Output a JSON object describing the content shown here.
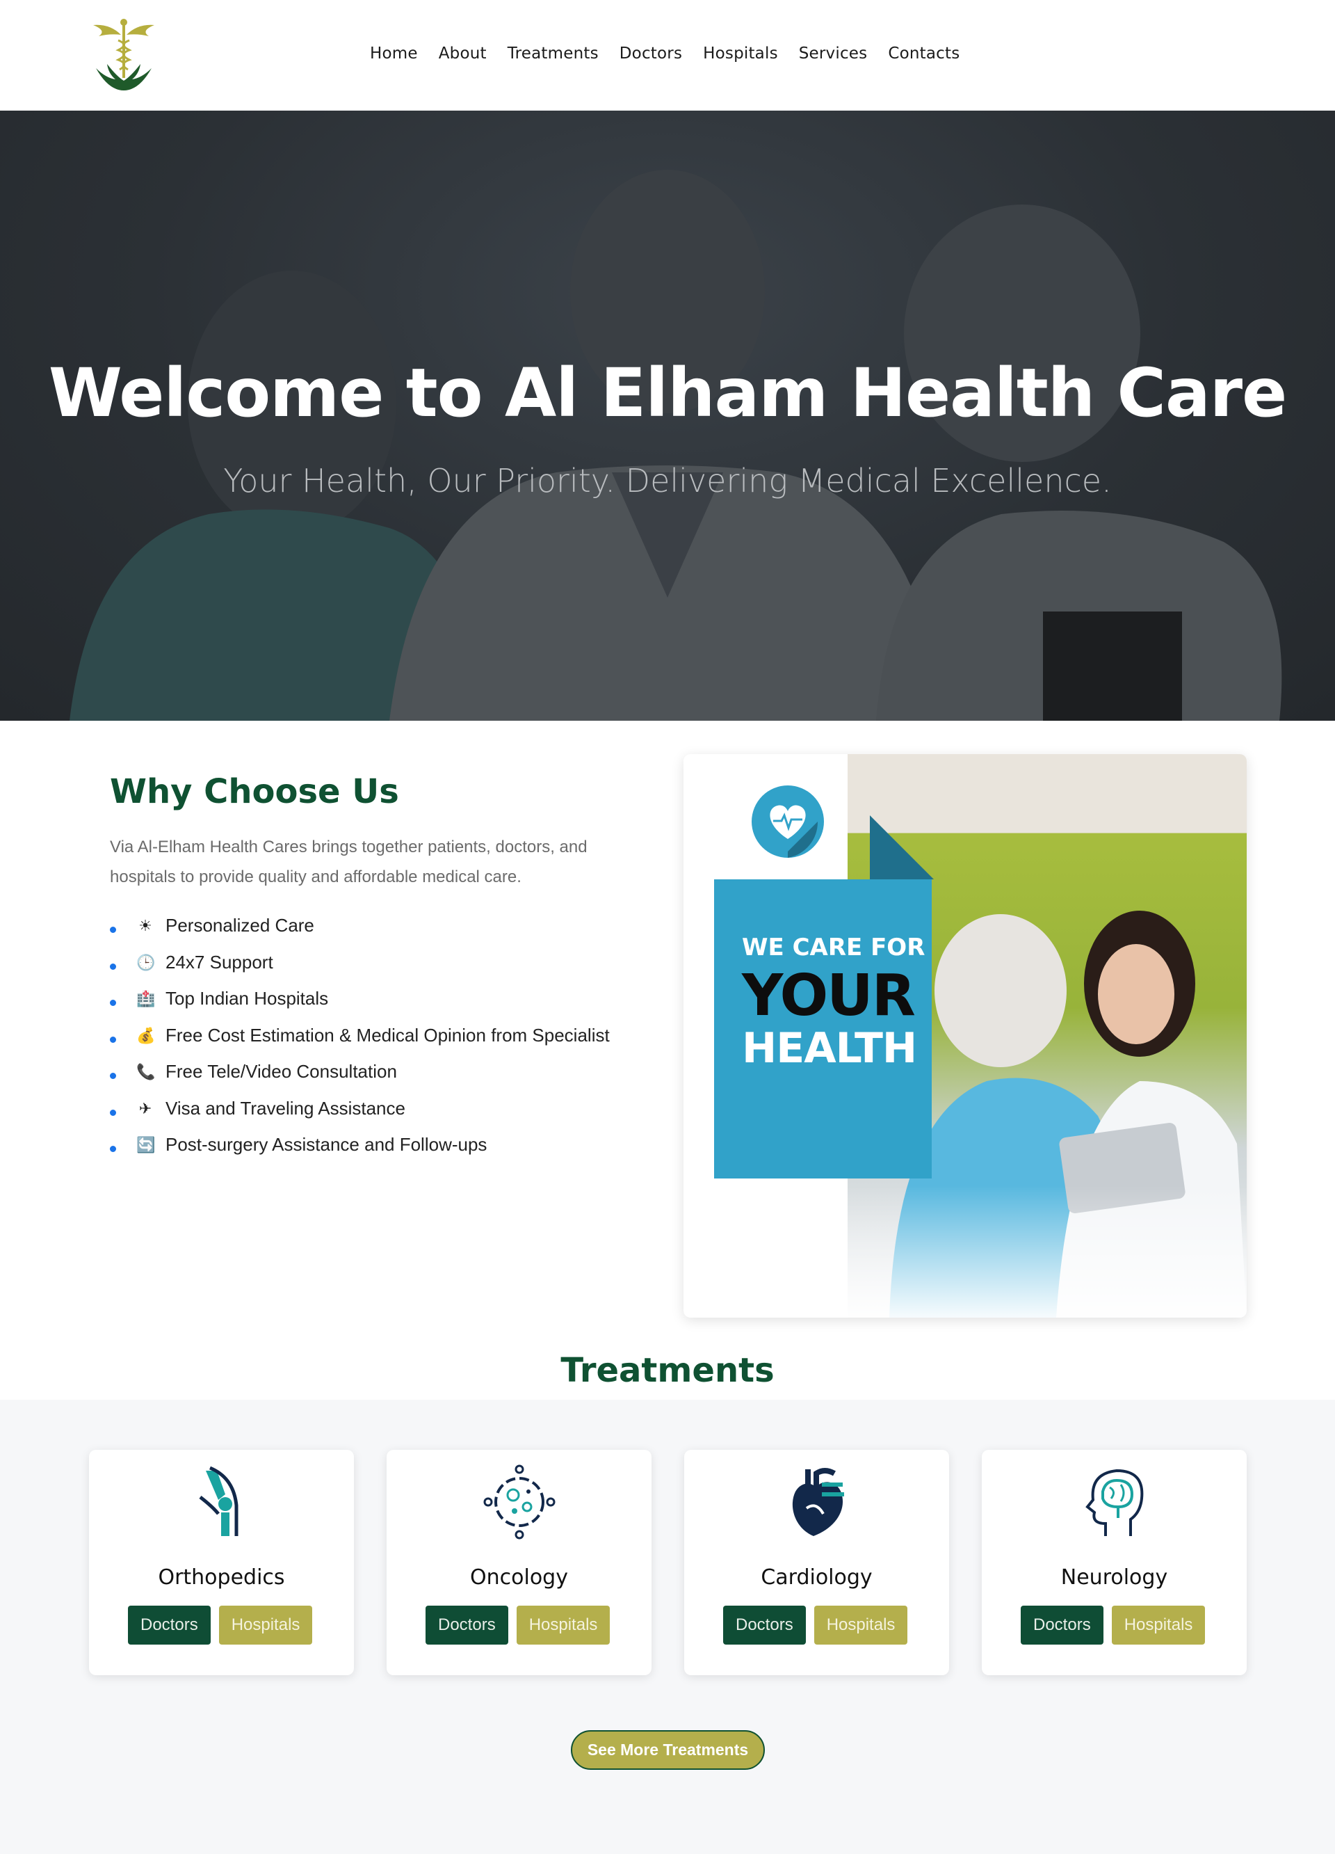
{
  "brand": {
    "colors": {
      "primary": "#0f5132",
      "accent": "#b4af4c",
      "hero_bg": "#2b3035",
      "blue": "#31a2c9"
    }
  },
  "nav": {
    "items": [
      "Home",
      "About",
      "Treatments",
      "Doctors",
      "Hospitals",
      "Services",
      "Contacts"
    ]
  },
  "hero": {
    "title": "Welcome to Al Elham Health Care",
    "subtitle": "Your Health, Our Priority. Delivering Medical Excellence."
  },
  "why": {
    "title": "Why Choose Us",
    "intro": "Via Al-Elham Health Cares brings together patients, doctors, and hospitals to provide quality and affordable medical care.",
    "items": [
      {
        "icon": "sun-icon",
        "glyph": "☀",
        "label": "Personalized Care"
      },
      {
        "icon": "clock-icon",
        "glyph": "🕒",
        "label": "24x7 Support"
      },
      {
        "icon": "hospital-icon",
        "glyph": "🏥",
        "label": "Top Indian Hospitals"
      },
      {
        "icon": "money-bag-icon",
        "glyph": "💰",
        "label": "Free Cost Estimation & Medical Opinion from Specialist"
      },
      {
        "icon": "phone-icon",
        "glyph": "📞",
        "label": "Free Tele/Video Consultation"
      },
      {
        "icon": "airplane-icon",
        "glyph": "✈",
        "label": "Visa and Traveling Assistance"
      },
      {
        "icon": "refresh-icon",
        "glyph": "🔄",
        "label": "Post-surgery Assistance and Follow-ups"
      }
    ]
  },
  "care_card": {
    "line1": "WE CARE FOR",
    "line2": "YOUR",
    "line3": "HEALTH"
  },
  "treatments": {
    "title": "Treatments",
    "cards": [
      {
        "name": "Orthopedics",
        "icon": "knee-joint-icon",
        "doctors": "Doctors",
        "hospitals": "Hospitals"
      },
      {
        "name": "Oncology",
        "icon": "cell-icon",
        "doctors": "Doctors",
        "hospitals": "Hospitals"
      },
      {
        "name": "Cardiology",
        "icon": "heart-icon",
        "doctors": "Doctors",
        "hospitals": "Hospitals"
      },
      {
        "name": "Neurology",
        "icon": "brain-icon",
        "doctors": "Doctors",
        "hospitals": "Hospitals"
      }
    ],
    "see_more": "See More Treatments"
  }
}
